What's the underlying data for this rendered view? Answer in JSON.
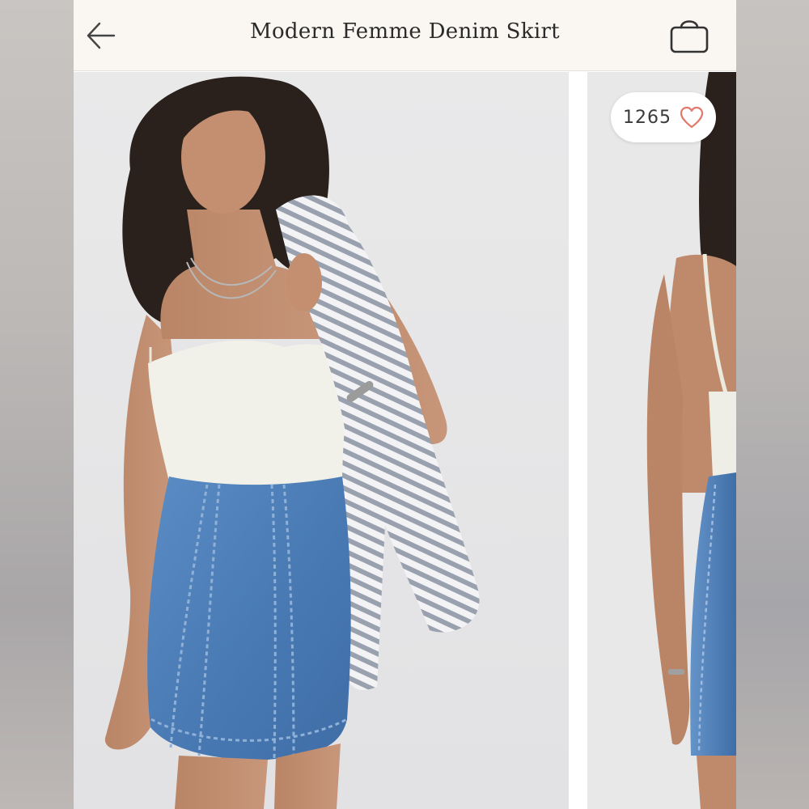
{
  "header": {
    "title": "Modern Femme Denim Skirt",
    "back_icon": "arrow-left-icon",
    "bag_icon": "shopping-bag-icon"
  },
  "gallery": {
    "likes": {
      "count": "1265",
      "icon": "heart-outline-icon",
      "color": "#e07a6b"
    },
    "images": [
      {
        "name": "main-product-photo"
      },
      {
        "name": "secondary-product-photo"
      }
    ]
  },
  "colors": {
    "header_bg": "#faf7f2",
    "photo_bg": "#e7e7e8",
    "denim": "#4f7fb8"
  }
}
